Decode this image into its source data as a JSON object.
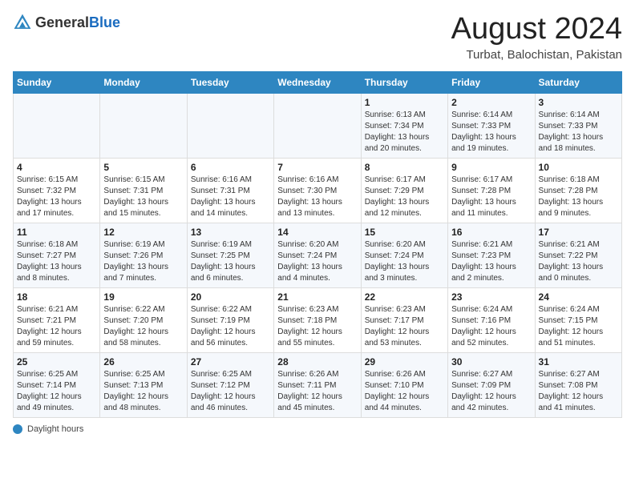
{
  "logo": {
    "text_general": "General",
    "text_blue": "Blue"
  },
  "header": {
    "month_year": "August 2024",
    "location": "Turbat, Balochistan, Pakistan"
  },
  "days_of_week": [
    "Sunday",
    "Monday",
    "Tuesday",
    "Wednesday",
    "Thursday",
    "Friday",
    "Saturday"
  ],
  "weeks": [
    [
      {
        "day": "",
        "content": ""
      },
      {
        "day": "",
        "content": ""
      },
      {
        "day": "",
        "content": ""
      },
      {
        "day": "",
        "content": ""
      },
      {
        "day": "1",
        "content": "Sunrise: 6:13 AM\nSunset: 7:34 PM\nDaylight: 13 hours\nand 20 minutes."
      },
      {
        "day": "2",
        "content": "Sunrise: 6:14 AM\nSunset: 7:33 PM\nDaylight: 13 hours\nand 19 minutes."
      },
      {
        "day": "3",
        "content": "Sunrise: 6:14 AM\nSunset: 7:33 PM\nDaylight: 13 hours\nand 18 minutes."
      }
    ],
    [
      {
        "day": "4",
        "content": "Sunrise: 6:15 AM\nSunset: 7:32 PM\nDaylight: 13 hours\nand 17 minutes."
      },
      {
        "day": "5",
        "content": "Sunrise: 6:15 AM\nSunset: 7:31 PM\nDaylight: 13 hours\nand 15 minutes."
      },
      {
        "day": "6",
        "content": "Sunrise: 6:16 AM\nSunset: 7:31 PM\nDaylight: 13 hours\nand 14 minutes."
      },
      {
        "day": "7",
        "content": "Sunrise: 6:16 AM\nSunset: 7:30 PM\nDaylight: 13 hours\nand 13 minutes."
      },
      {
        "day": "8",
        "content": "Sunrise: 6:17 AM\nSunset: 7:29 PM\nDaylight: 13 hours\nand 12 minutes."
      },
      {
        "day": "9",
        "content": "Sunrise: 6:17 AM\nSunset: 7:28 PM\nDaylight: 13 hours\nand 11 minutes."
      },
      {
        "day": "10",
        "content": "Sunrise: 6:18 AM\nSunset: 7:28 PM\nDaylight: 13 hours\nand 9 minutes."
      }
    ],
    [
      {
        "day": "11",
        "content": "Sunrise: 6:18 AM\nSunset: 7:27 PM\nDaylight: 13 hours\nand 8 minutes."
      },
      {
        "day": "12",
        "content": "Sunrise: 6:19 AM\nSunset: 7:26 PM\nDaylight: 13 hours\nand 7 minutes."
      },
      {
        "day": "13",
        "content": "Sunrise: 6:19 AM\nSunset: 7:25 PM\nDaylight: 13 hours\nand 6 minutes."
      },
      {
        "day": "14",
        "content": "Sunrise: 6:20 AM\nSunset: 7:24 PM\nDaylight: 13 hours\nand 4 minutes."
      },
      {
        "day": "15",
        "content": "Sunrise: 6:20 AM\nSunset: 7:24 PM\nDaylight: 13 hours\nand 3 minutes."
      },
      {
        "day": "16",
        "content": "Sunrise: 6:21 AM\nSunset: 7:23 PM\nDaylight: 13 hours\nand 2 minutes."
      },
      {
        "day": "17",
        "content": "Sunrise: 6:21 AM\nSunset: 7:22 PM\nDaylight: 13 hours\nand 0 minutes."
      }
    ],
    [
      {
        "day": "18",
        "content": "Sunrise: 6:21 AM\nSunset: 7:21 PM\nDaylight: 12 hours\nand 59 minutes."
      },
      {
        "day": "19",
        "content": "Sunrise: 6:22 AM\nSunset: 7:20 PM\nDaylight: 12 hours\nand 58 minutes."
      },
      {
        "day": "20",
        "content": "Sunrise: 6:22 AM\nSunset: 7:19 PM\nDaylight: 12 hours\nand 56 minutes."
      },
      {
        "day": "21",
        "content": "Sunrise: 6:23 AM\nSunset: 7:18 PM\nDaylight: 12 hours\nand 55 minutes."
      },
      {
        "day": "22",
        "content": "Sunrise: 6:23 AM\nSunset: 7:17 PM\nDaylight: 12 hours\nand 53 minutes."
      },
      {
        "day": "23",
        "content": "Sunrise: 6:24 AM\nSunset: 7:16 PM\nDaylight: 12 hours\nand 52 minutes."
      },
      {
        "day": "24",
        "content": "Sunrise: 6:24 AM\nSunset: 7:15 PM\nDaylight: 12 hours\nand 51 minutes."
      }
    ],
    [
      {
        "day": "25",
        "content": "Sunrise: 6:25 AM\nSunset: 7:14 PM\nDaylight: 12 hours\nand 49 minutes."
      },
      {
        "day": "26",
        "content": "Sunrise: 6:25 AM\nSunset: 7:13 PM\nDaylight: 12 hours\nand 48 minutes."
      },
      {
        "day": "27",
        "content": "Sunrise: 6:25 AM\nSunset: 7:12 PM\nDaylight: 12 hours\nand 46 minutes."
      },
      {
        "day": "28",
        "content": "Sunrise: 6:26 AM\nSunset: 7:11 PM\nDaylight: 12 hours\nand 45 minutes."
      },
      {
        "day": "29",
        "content": "Sunrise: 6:26 AM\nSunset: 7:10 PM\nDaylight: 12 hours\nand 44 minutes."
      },
      {
        "day": "30",
        "content": "Sunrise: 6:27 AM\nSunset: 7:09 PM\nDaylight: 12 hours\nand 42 minutes."
      },
      {
        "day": "31",
        "content": "Sunrise: 6:27 AM\nSunset: 7:08 PM\nDaylight: 12 hours\nand 41 minutes."
      }
    ]
  ],
  "footer": {
    "label": "Daylight hours"
  }
}
